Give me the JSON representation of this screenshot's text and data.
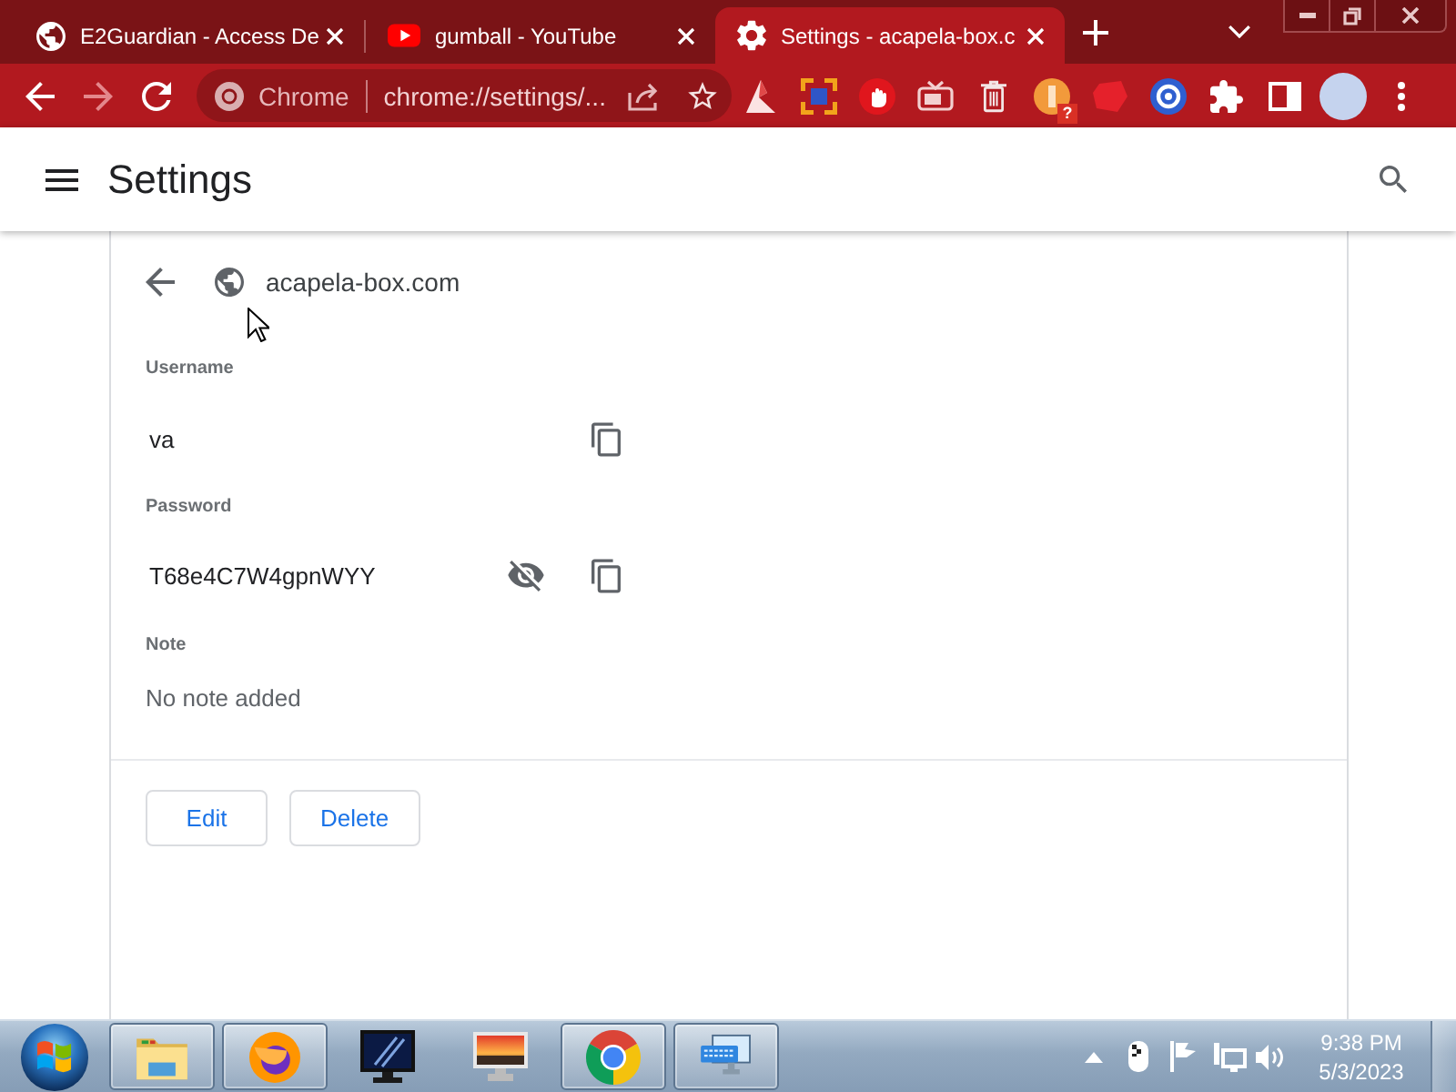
{
  "tabs": [
    {
      "title": "E2Guardian - Access De",
      "selected": false
    },
    {
      "title": "gumball - YouTube",
      "selected": false
    },
    {
      "title": "Settings - acapela-box.c",
      "selected": true
    }
  ],
  "toolbar": {
    "forward_disabled": true,
    "omnibox": {
      "chip": "Chrome",
      "url": "chrome://settings/..."
    },
    "extension_badge": "?"
  },
  "header": {
    "title": "Settings"
  },
  "entry": {
    "site": "acapela-box.com",
    "username": {
      "label": "Username",
      "value": "va"
    },
    "password": {
      "label": "Password",
      "value": "T68e4C7W4gpnWYY",
      "revealed": true
    },
    "note": {
      "label": "Note",
      "value": "No note added"
    },
    "buttons": [
      "Edit",
      "Delete"
    ]
  },
  "taskbar": {
    "apps": [
      {
        "running": true
      },
      {
        "running": true
      },
      {
        "running": false
      },
      {
        "running": false
      },
      {
        "running": true
      },
      {
        "running": true
      }
    ],
    "clock": {
      "time": "9:38 PM",
      "date": "5/3/2023"
    }
  }
}
